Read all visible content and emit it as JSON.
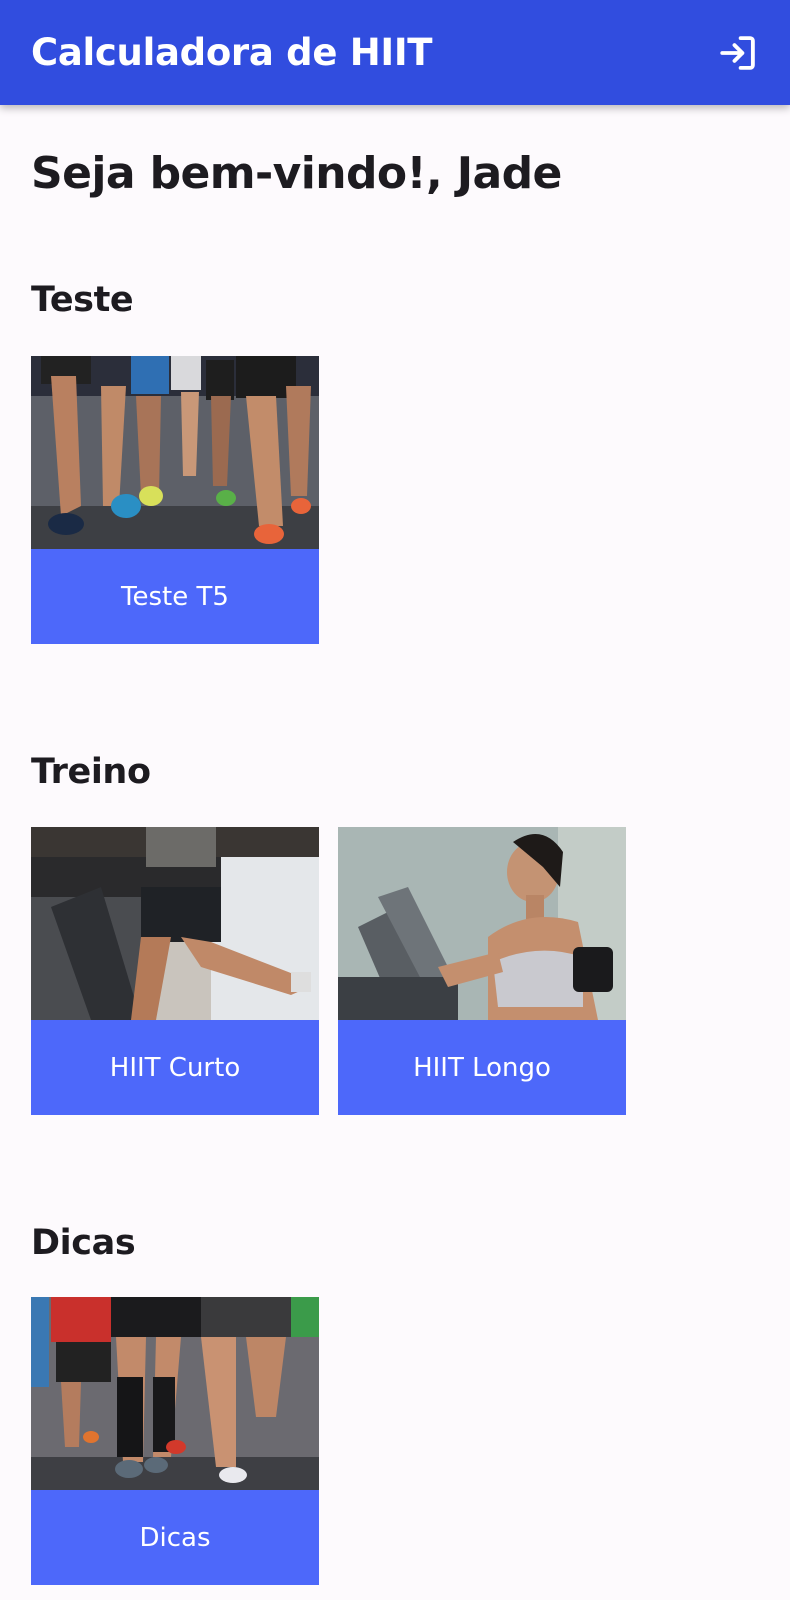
{
  "appbar": {
    "title": "Calculadora de HIIT",
    "logout_icon": "login-arrow-icon",
    "background_color": "#314ddf"
  },
  "greeting": "Seja bem-vindo!, Jade",
  "accent_color": "#4d68fa",
  "sections": [
    {
      "title": "Teste",
      "cards": [
        {
          "label": "Teste T5",
          "image": "runners-race-legs-photo"
        }
      ]
    },
    {
      "title": "Treino",
      "cards": [
        {
          "label": "HIIT Curto",
          "image": "treadmill-running-legs-photo"
        },
        {
          "label": "HIIT Longo",
          "image": "woman-on-treadmill-photo"
        }
      ]
    },
    {
      "title": "Dicas",
      "cards": [
        {
          "label": "Dicas",
          "image": "marathon-runners-legs-photo"
        }
      ]
    }
  ]
}
